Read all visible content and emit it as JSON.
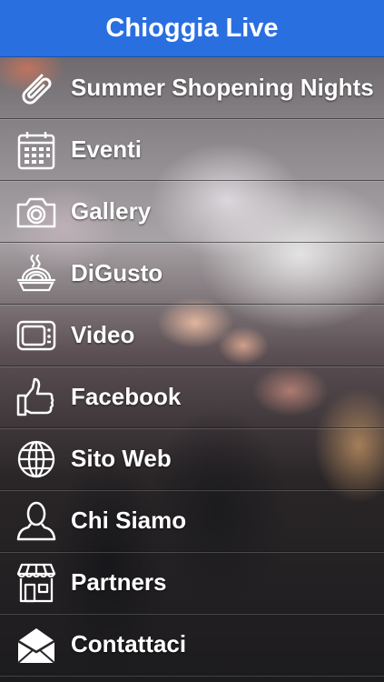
{
  "header": {
    "title": "Chioggia Live"
  },
  "menu": {
    "items": [
      {
        "label": "Summer Shopening Nights",
        "icon": "paperclip-icon"
      },
      {
        "label": "Eventi",
        "icon": "calendar-icon"
      },
      {
        "label": "Gallery",
        "icon": "camera-icon"
      },
      {
        "label": "DiGusto",
        "icon": "food-bowl-icon"
      },
      {
        "label": "Video",
        "icon": "tv-icon"
      },
      {
        "label": "Facebook",
        "icon": "thumbs-up-icon"
      },
      {
        "label": "Sito Web",
        "icon": "globe-icon"
      },
      {
        "label": "Chi Siamo",
        "icon": "user-icon"
      },
      {
        "label": "Partners",
        "icon": "store-icon"
      },
      {
        "label": "Contattaci",
        "icon": "envelope-icon"
      }
    ]
  },
  "colors": {
    "header": "#2a6fe0",
    "text": "#ffffff"
  }
}
